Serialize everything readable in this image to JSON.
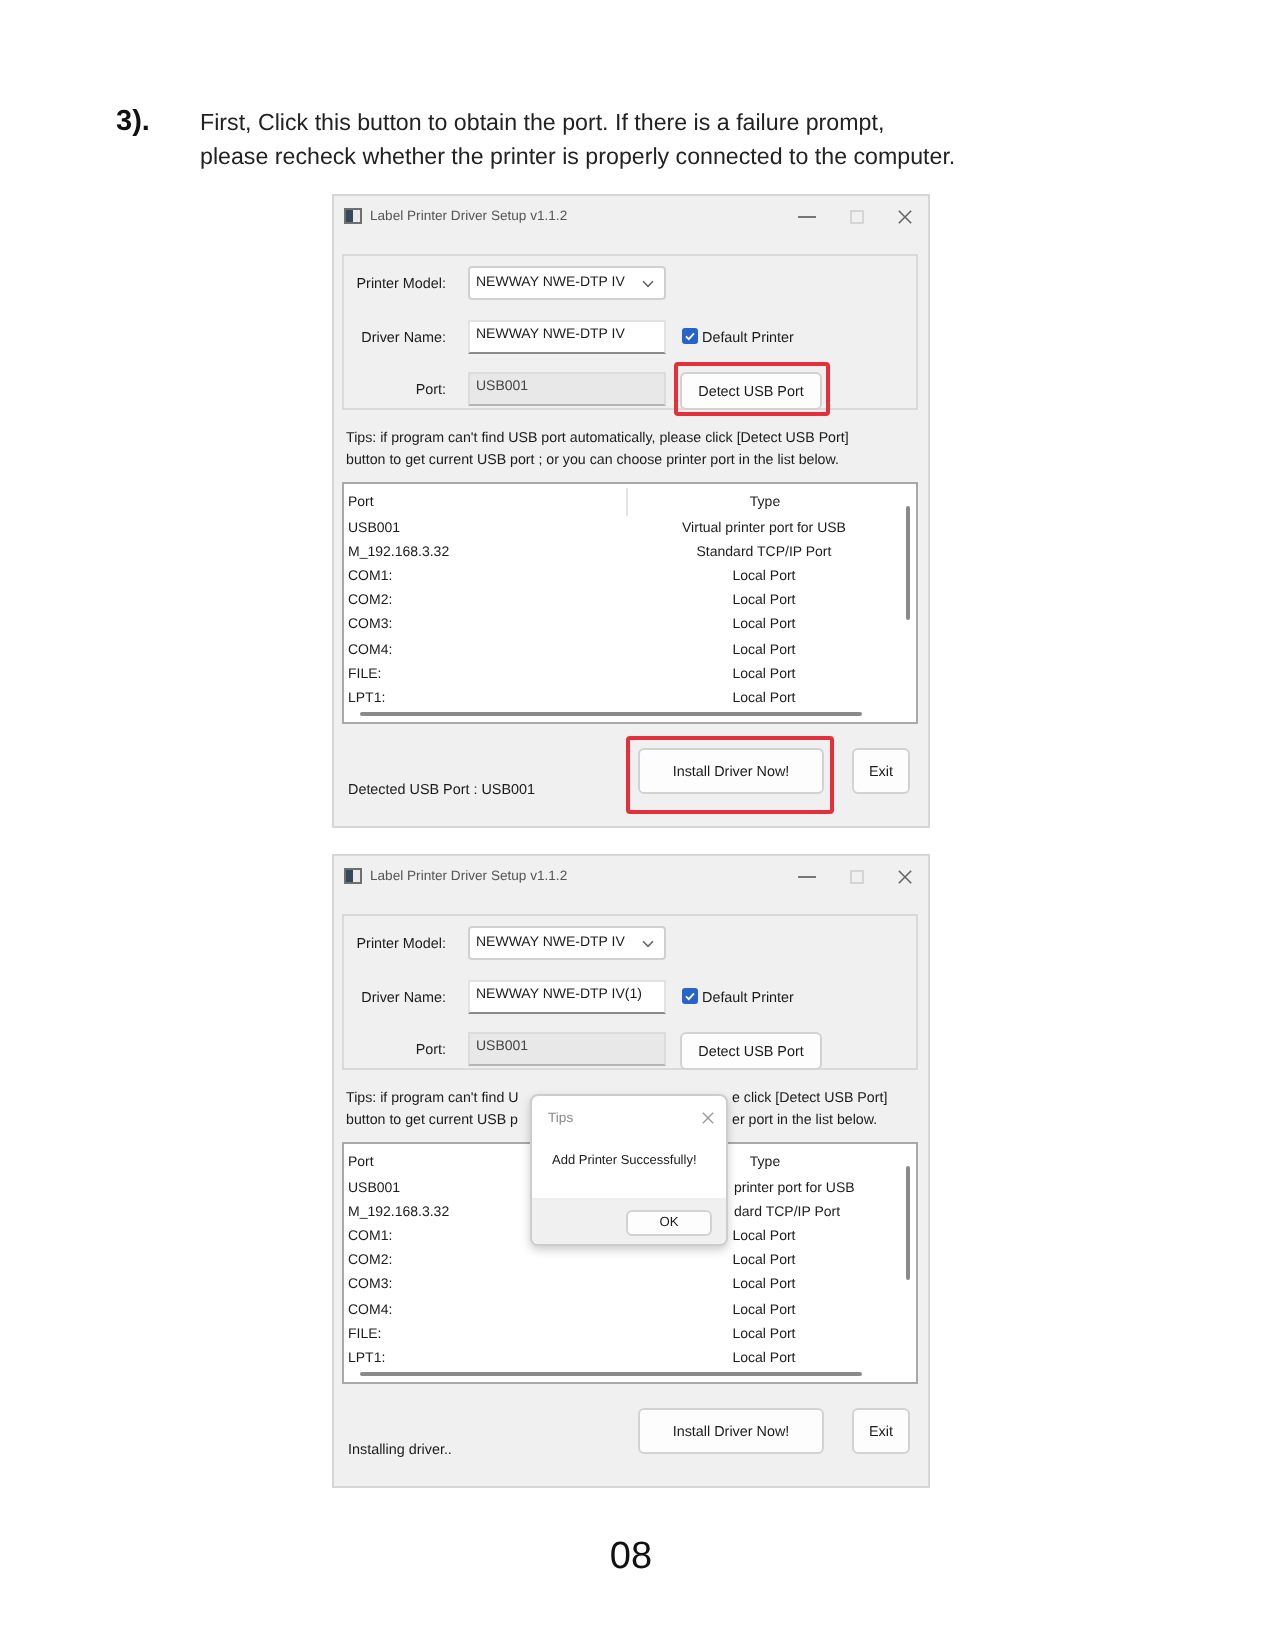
{
  "instruction": {
    "step": "3).",
    "lines": [
      "First, Click this button to obtain the port. If there is a failure prompt,",
      "please recheck whether the printer is properly connected to the computer."
    ]
  },
  "windows": [
    {
      "title": "Label Printer Driver Setup v1.1.2",
      "printer_model": {
        "label": "Printer Model:",
        "value": "NEWWAY NWE-DTP IV"
      },
      "driver_name": {
        "label": "Driver Name:",
        "value": "NEWWAY NWE-DTP IV"
      },
      "default_printer": {
        "label": "Default Printer",
        "checked": true
      },
      "port": {
        "label": "Port:",
        "value": "USB001",
        "disabled": true
      },
      "detect_button": {
        "label": "Detect USB Port",
        "highlighted": true
      },
      "tips": [
        "Tips: if program can't find USB port automatically, please click [Detect USB Port]",
        "button to get current USB port ; or you can choose printer port in the list below."
      ],
      "port_list": {
        "columns": [
          "Port",
          "Type"
        ],
        "rows": [
          {
            "port": "USB001",
            "type": "Virtual printer port for USB"
          },
          {
            "port": "M_192.168.3.32",
            "type": "Standard TCP/IP Port"
          },
          {
            "port": "COM1:",
            "type": "Local Port"
          },
          {
            "port": "COM2:",
            "type": "Local Port"
          },
          {
            "port": "COM3:",
            "type": "Local Port"
          },
          {
            "port": "COM4:",
            "type": "Local Port"
          },
          {
            "port": "FILE:",
            "type": "Local Port"
          },
          {
            "port": "LPT1:",
            "type": "Local Port"
          }
        ]
      },
      "status": "Detected USB Port : USB001",
      "install_button": {
        "label": "Install Driver Now!",
        "highlighted": true
      },
      "exit_button": "Exit"
    },
    {
      "title": "Label Printer Driver Setup v1.1.2",
      "printer_model": {
        "label": "Printer Model:",
        "value": "NEWWAY NWE-DTP IV"
      },
      "driver_name": {
        "label": "Driver Name:",
        "value": "NEWWAY NWE-DTP IV(1)"
      },
      "default_printer": {
        "label": "Default Printer",
        "checked": true
      },
      "port": {
        "label": "Port:",
        "value": "USB001",
        "disabled": true
      },
      "detect_button": {
        "label": "Detect USB Port",
        "highlighted": false
      },
      "tips": [
        "Tips: if program can't find U",
        "button to get current USB p"
      ],
      "tips_after_dialog": [
        "e click [Detect USB Port]",
        "er port in the list below."
      ],
      "port_list": {
        "columns": [
          "Port",
          "Type"
        ],
        "rows": [
          {
            "port": "USB001",
            "type": "printer port for USB",
            "covered": true
          },
          {
            "port": "M_192.168.3.32",
            "type": "dard TCP/IP Port",
            "covered": true
          },
          {
            "port": "COM1:",
            "type": "Local Port",
            "covered": false
          },
          {
            "port": "COM2:",
            "type": "Local Port",
            "covered": false
          },
          {
            "port": "COM3:",
            "type": "Local Port",
            "covered": false
          },
          {
            "port": "COM4:",
            "type": "Local Port",
            "covered": false
          },
          {
            "port": "FILE:",
            "type": "Local Port",
            "covered": false
          },
          {
            "port": "LPT1:",
            "type": "Local Port",
            "covered": false
          }
        ]
      },
      "status": "Installing driver..",
      "install_button": {
        "label": "Install Driver Now!",
        "highlighted": false
      },
      "exit_button": "Exit",
      "dialog": {
        "title": "Tips",
        "message": "Add Printer Successfully!",
        "button": "OK"
      }
    }
  ],
  "page_number": "08"
}
